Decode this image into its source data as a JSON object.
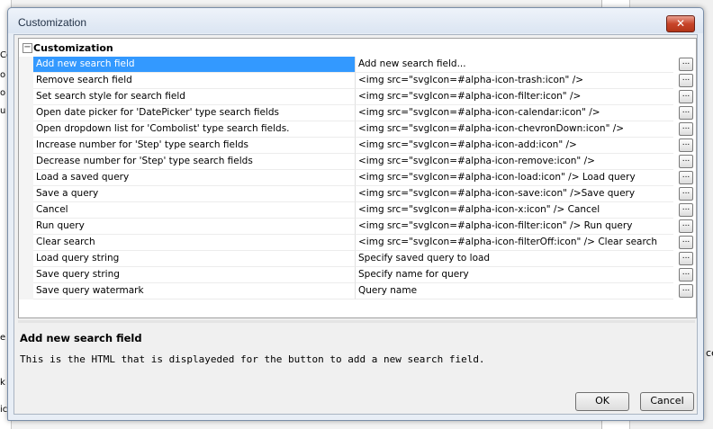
{
  "dialog": {
    "title": "Customization",
    "close_label": "✕"
  },
  "background": {
    "left_fragments": [
      "Co",
      "o",
      "o",
      "u",
      "e",
      "k",
      "ic"
    ],
    "right_fragment": "ce"
  },
  "tree": {
    "category": {
      "toggle": "−",
      "label": "Customization"
    },
    "rows": [
      {
        "name": "Add new search field",
        "value": "Add new search field..."
      },
      {
        "name": "Remove search field",
        "value": "<img src=\"svgIcon=#alpha-icon-trash:icon\" />"
      },
      {
        "name": "Set search style for search field",
        "value": "<img src=\"svgIcon=#alpha-icon-filter:icon\" />"
      },
      {
        "name": "Open date picker for 'DatePicker' type search fields",
        "value": "<img src=\"svgIcon=#alpha-icon-calendar:icon\" />"
      },
      {
        "name": "Open dropdown list for 'Combolist' type search fields.",
        "value": "<img src=\"svgIcon=#alpha-icon-chevronDown:icon\" />"
      },
      {
        "name": "Increase number for 'Step' type search fields",
        "value": "<img src=\"svgIcon=#alpha-icon-add:icon\" />"
      },
      {
        "name": "Decrease number for 'Step' type search fields",
        "value": "<img src=\"svgIcon=#alpha-icon-remove:icon\" />"
      },
      {
        "name": "Load a saved query",
        "value": "<img src=\"svgIcon=#alpha-icon-load:icon\" /> Load query"
      },
      {
        "name": "Save a query",
        "value": "<img src=\"svgIcon=#alpha-icon-save:icon\" />Save query"
      },
      {
        "name": "Cancel",
        "value": "<img src=\"svgIcon=#alpha-icon-x:icon\" /> Cancel"
      },
      {
        "name": "Run query",
        "value": "<img src=\"svgIcon=#alpha-icon-filter:icon\" /> Run query"
      },
      {
        "name": "Clear search",
        "value": "<img src=\"svgIcon=#alpha-icon-filterOff:icon\" /> Clear search"
      },
      {
        "name": "Load query string",
        "value": "Specify saved query to load"
      },
      {
        "name": "Save query string",
        "value": "Specify name for query"
      },
      {
        "name": "Save query watermark",
        "value": "Query name"
      }
    ],
    "ellipsis_label": "..."
  },
  "description": {
    "title": "Add new search field",
    "text": "This is the HTML that is displayeded for the button to add a new search field."
  },
  "buttons": {
    "ok": "OK",
    "cancel": "Cancel"
  }
}
